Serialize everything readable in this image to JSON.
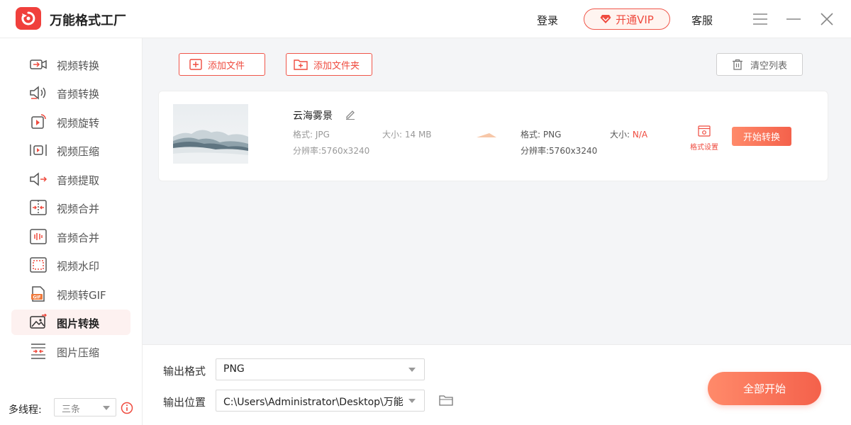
{
  "app": {
    "title": "万能格式工厂",
    "brand_color": "#f0403c"
  },
  "titlebar": {
    "login": "登录",
    "vip": "开通VIP",
    "service": "客服",
    "menu_icon": "menu-icon",
    "minimize_icon": "minimize-icon",
    "close_icon": "close-icon"
  },
  "sidebar": {
    "items": [
      {
        "label": "视频转换",
        "icon": "video-convert-icon",
        "active": false
      },
      {
        "label": "音频转换",
        "icon": "audio-convert-icon",
        "active": false
      },
      {
        "label": "视频旋转",
        "icon": "video-rotate-icon",
        "active": false
      },
      {
        "label": "视频压缩",
        "icon": "video-compress-icon",
        "active": false
      },
      {
        "label": "音频提取",
        "icon": "audio-extract-icon",
        "active": false
      },
      {
        "label": "视频合并",
        "icon": "video-merge-icon",
        "active": false
      },
      {
        "label": "音频合并",
        "icon": "audio-merge-icon",
        "active": false
      },
      {
        "label": "视频水印",
        "icon": "video-watermark-icon",
        "active": false
      },
      {
        "label": "视频转GIF",
        "icon": "video-gif-icon",
        "active": false
      },
      {
        "label": "图片转换",
        "icon": "image-convert-icon",
        "active": true
      },
      {
        "label": "图片压缩",
        "icon": "image-compress-icon",
        "active": false
      }
    ],
    "thread_label": "多线程:",
    "thread_value": "三条"
  },
  "toolbar": {
    "add_file": "添加文件",
    "add_folder": "添加文件夹",
    "clear_list": "清空列表"
  },
  "file": {
    "name": "云海雾景",
    "source_format": "格式: JPG",
    "source_size": "大小: 14 MB",
    "source_resolution": "分辨率:5760x3240",
    "target_format": "格式: PNG",
    "target_size_label": "大小:",
    "target_size_value": "N/A",
    "target_resolution": "分辨率:5760x3240",
    "format_setting": "格式设置",
    "start_button": "开始转换"
  },
  "bottom": {
    "output_format_label": "输出格式",
    "output_format_value": "PNG",
    "output_path_label": "输出位置",
    "output_path_value": "C:\\Users\\Administrator\\Desktop\\万能",
    "start_all": "全部开始"
  }
}
